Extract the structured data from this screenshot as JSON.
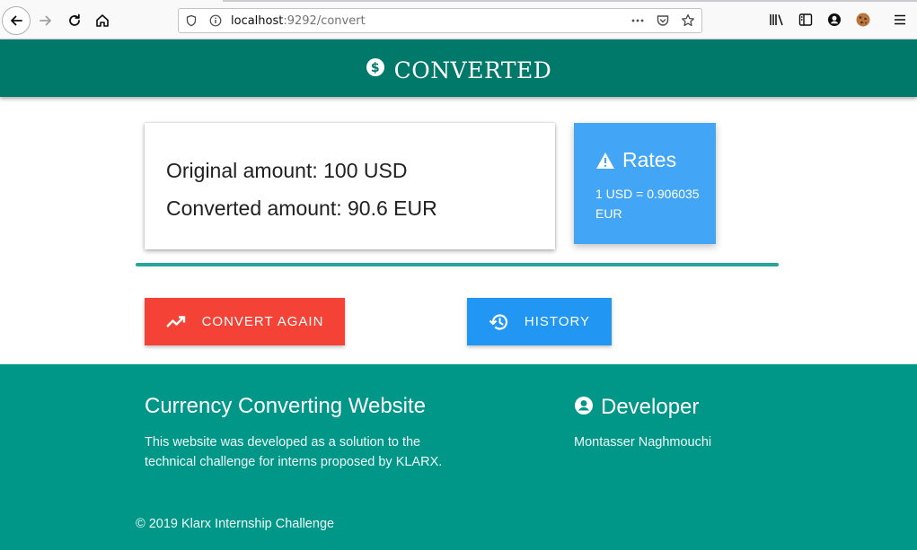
{
  "browser": {
    "url_host": "localhost",
    "url_rest": ":9292/convert",
    "icons": [
      "back-icon",
      "forward-icon",
      "reload-icon",
      "home-icon",
      "shield-icon",
      "info-icon",
      "more-icon",
      "pocket-icon",
      "bookmark-star-icon",
      "library-icon",
      "sidebar-icon",
      "account-icon",
      "cookie-icon",
      "menu-icon"
    ]
  },
  "header": {
    "title": "CONVERTED",
    "icon": "dollar-circle-icon"
  },
  "result": {
    "original": "Original amount: 100 USD",
    "converted": "Converted amount: 90.6 EUR"
  },
  "rates": {
    "title": "Rates",
    "text": "1 USD = 0.906035 EUR"
  },
  "buttons": {
    "convert_again": "CONVERT AGAIN",
    "history": "HISTORY"
  },
  "footer": {
    "title": "Currency Converting Website",
    "description": "This website was developed as a solution to the technical challenge for interns proposed by KLARX.",
    "developer_heading": "Developer",
    "developer_name": "Montasser Naghmouchi",
    "copyright": "© 2019 Klarx Internship Challenge"
  },
  "colors": {
    "header": "#00796b",
    "footer": "#009688",
    "rates_card": "#42a5f5",
    "convert_button": "#f44336",
    "history_button": "#2196f3",
    "divider": "#26a69a"
  }
}
